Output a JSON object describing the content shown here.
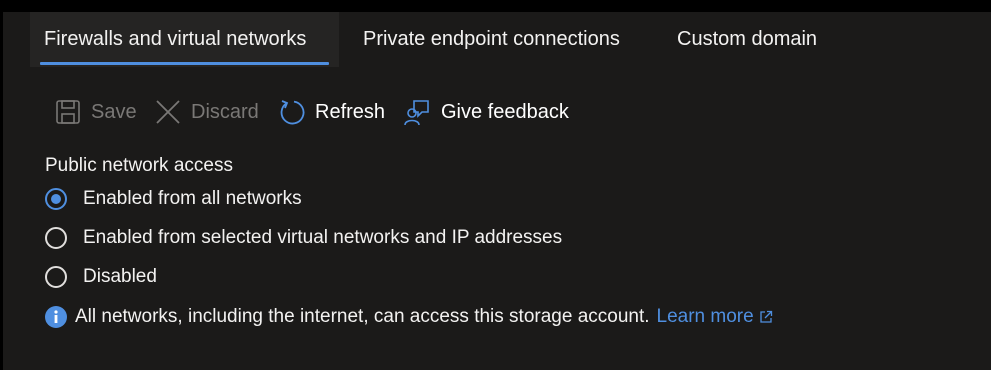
{
  "tabs": [
    {
      "label": "Firewalls and virtual networks",
      "active": true
    },
    {
      "label": "Private endpoint connections",
      "active": false
    },
    {
      "label": "Custom domain",
      "active": false
    }
  ],
  "toolbar": {
    "save_label": "Save",
    "discard_label": "Discard",
    "refresh_label": "Refresh",
    "feedback_label": "Give feedback",
    "icons": [
      "save-icon",
      "discard-icon",
      "refresh-icon",
      "feedback-icon"
    ]
  },
  "public_access": {
    "label": "Public network access",
    "options": [
      {
        "label": "Enabled from all networks",
        "selected": true
      },
      {
        "label": "Enabled from selected virtual networks and IP addresses",
        "selected": false
      },
      {
        "label": "Disabled",
        "selected": false
      }
    ],
    "info_text": "All networks, including the internet, can access this storage account.",
    "learn_more": "Learn more"
  },
  "colors": {
    "background": "#1b1a19",
    "accent": "#4f8fe0",
    "text": "#f3f2f1",
    "disabled_text": "#7a7876"
  }
}
